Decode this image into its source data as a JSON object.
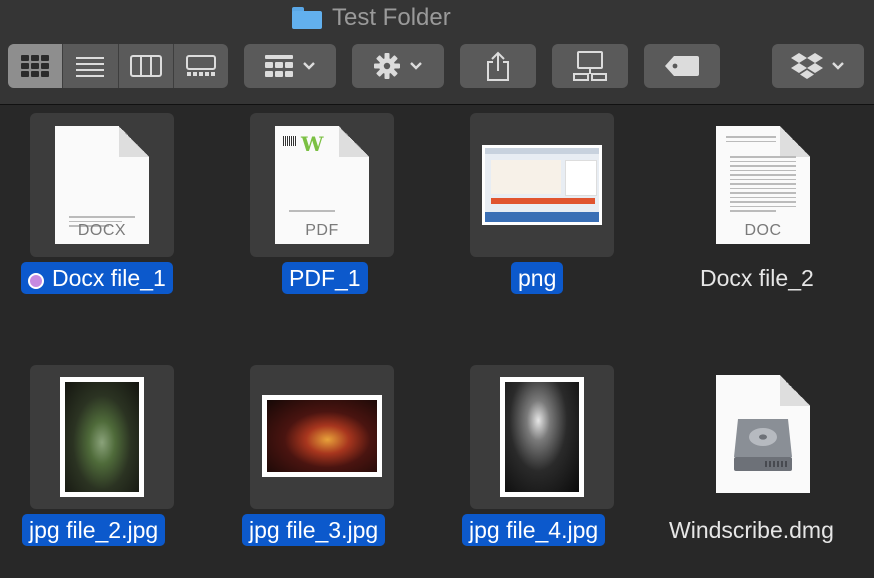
{
  "window": {
    "title": "Test Folder"
  },
  "toolbar": {
    "views": [
      "icon-view",
      "list-view",
      "column-view",
      "gallery-view"
    ],
    "active_view": "icon-view",
    "buttons": [
      "group-by",
      "action-gear",
      "share",
      "connect-server",
      "tags",
      "dropbox"
    ]
  },
  "files": [
    {
      "name": "Docx file_1",
      "type": "docx",
      "ext_label": "DOCX",
      "selected": true,
      "tag": "purple"
    },
    {
      "name": "PDF_1",
      "type": "pdf",
      "ext_label": "PDF",
      "selected": true
    },
    {
      "name": "png",
      "type": "png",
      "selected": true
    },
    {
      "name": "Docx file_2",
      "type": "doc",
      "ext_label": "DOC",
      "selected": false
    },
    {
      "name": "jpg file_2.jpg",
      "type": "jpg",
      "selected": true
    },
    {
      "name": "jpg file_3.jpg",
      "type": "jpg",
      "selected": true
    },
    {
      "name": "jpg file_4.jpg",
      "type": "jpg",
      "selected": true
    },
    {
      "name": "Windscribe.dmg",
      "type": "dmg",
      "selected": false
    }
  ],
  "colors": {
    "selection": "#0c59cc",
    "tag_purple": "#c78ae0",
    "folder": "#62b0ee"
  }
}
